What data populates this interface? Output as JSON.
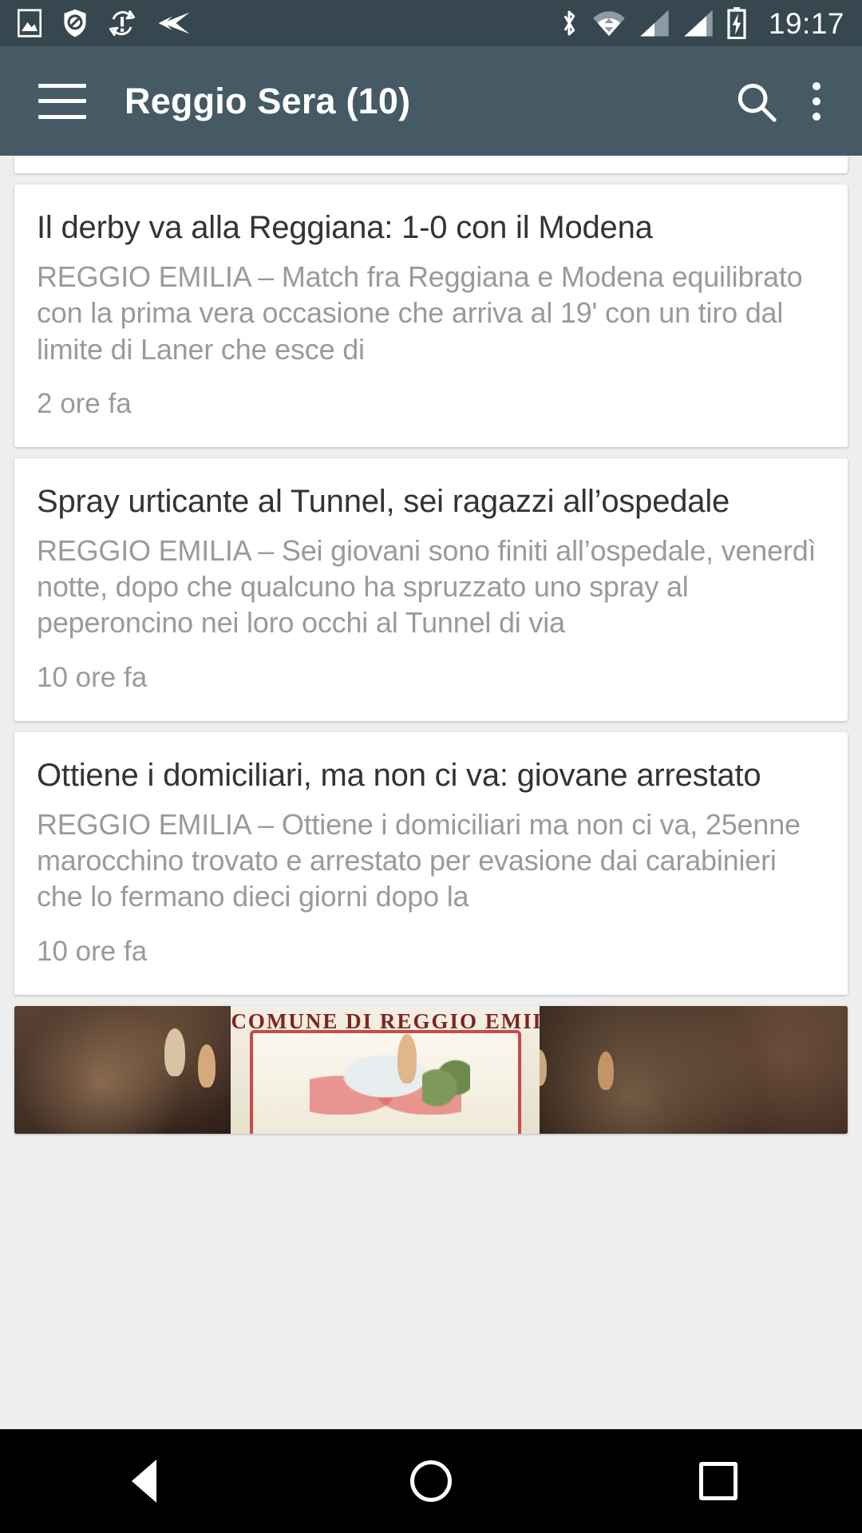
{
  "status_bar": {
    "icons_left": [
      "image-icon",
      "shield-block-icon",
      "sync-alert-icon",
      "arrow-left-media-icon"
    ],
    "icons_right": [
      "bluetooth-icon",
      "wifi-transfer-icon",
      "signal-bars-icon-1",
      "signal-bars-icon-2",
      "battery-charging-icon"
    ],
    "clock": "19:17",
    "background_color": "#37474f"
  },
  "app_bar": {
    "menu_icon": "hamburger-menu-icon",
    "title": "Reggio Sera (10)",
    "search_icon": "search-icon",
    "overflow_icon": "more-vertical-icon",
    "background_color": "#455a64"
  },
  "articles": [
    {
      "title": "Il derby va alla Reggiana: 1-0 con il Modena",
      "summary": "REGGIO EMILIA – Match fra Reggiana e Modena equilibrato con la prima vera occasione che arriva al 19' con un tiro dal limite di Laner che esce di",
      "time": "2 ore fa"
    },
    {
      "title": "Spray urticante al Tunnel, sei ragazzi all’ospedale",
      "summary": "REGGIO EMILIA – Sei giovani sono finiti all’ospedale, venerdì notte, dopo che qualcuno ha spruzzato uno spray al peperoncino nei loro occhi al Tunnel di via",
      "time": "10 ore fa"
    },
    {
      "title": "Ottiene i domiciliari, ma non ci va: giovane arrestato",
      "summary": "REGGIO EMILIA – Ottiene i domiciliari ma non ci va, 25enne marocchino trovato e arrestato per evasione dai carabinieri che lo fermano dieci giorni dopo la",
      "time": "10 ore fa"
    }
  ],
  "image_card": {
    "banner_text": "COMUNE DI REGGIO EMILIA",
    "alt": "ceremonial-banner-photo"
  },
  "nav_bar": {
    "back": "back-button",
    "home": "home-button",
    "recents": "recents-button"
  },
  "colors": {
    "status_bar": "#37474f",
    "app_bar": "#455a64",
    "page_background": "#eeeeee",
    "card": "#ffffff",
    "title_text": "#333333",
    "summary_text": "#9a9a9a"
  }
}
